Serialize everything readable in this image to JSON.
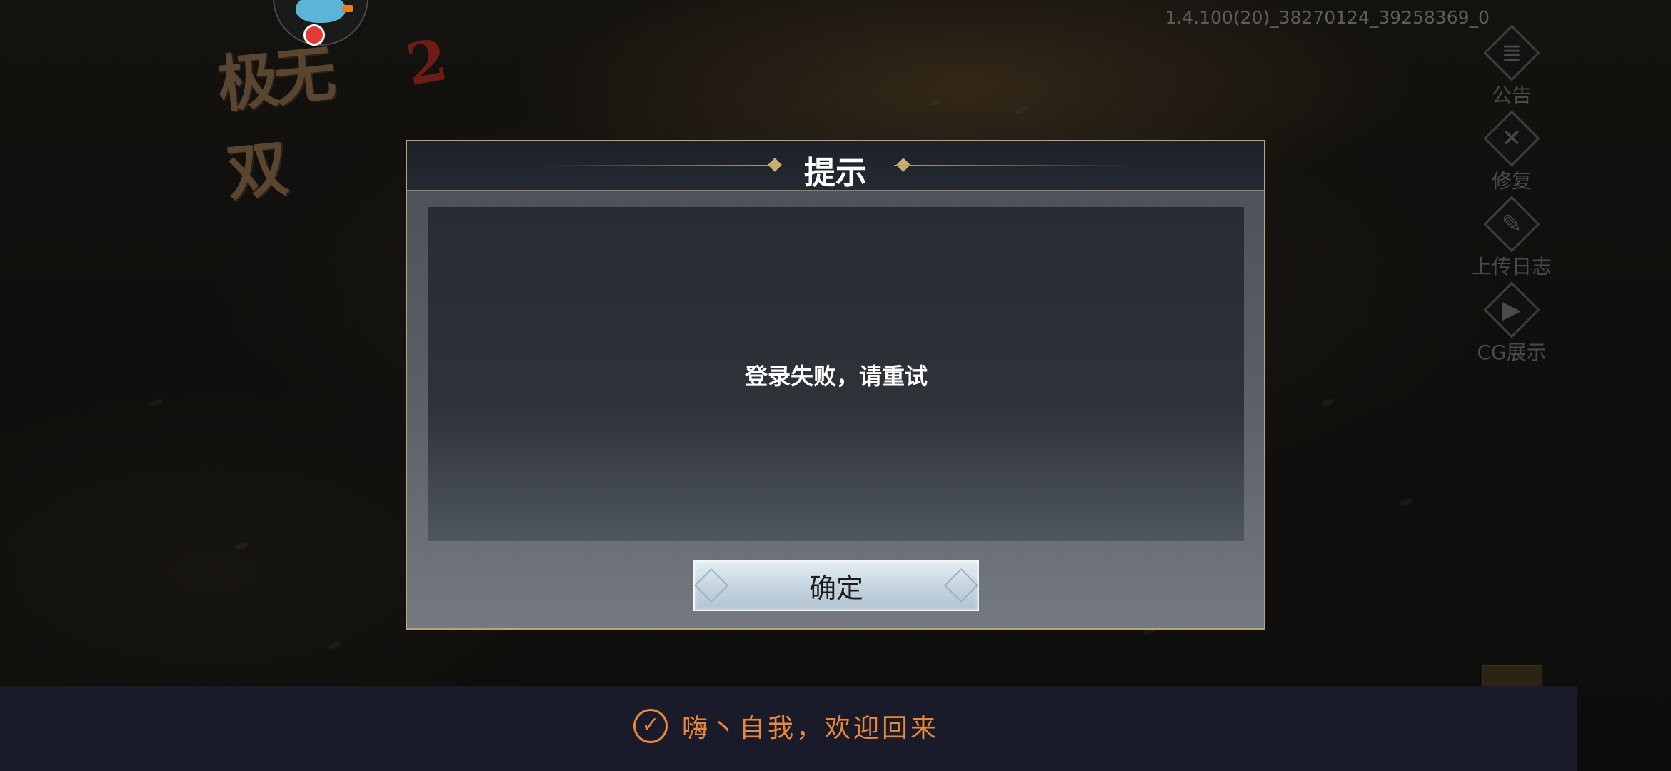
{
  "game": {
    "logo_text": "极无双",
    "logo_number": "2"
  },
  "version": "1.4.100(20)_38270124_39258369_0",
  "side_menu": [
    {
      "icon": "announcement-icon",
      "glyph": "≣",
      "label": "公告"
    },
    {
      "icon": "repair-icon",
      "glyph": "✕",
      "label": "修复"
    },
    {
      "icon": "upload-log-icon",
      "glyph": "✎",
      "label": "上传日志"
    },
    {
      "icon": "cg-video-icon",
      "glyph": "▶",
      "label": "CG展示"
    }
  ],
  "dialog": {
    "title": "提示",
    "message": "登录失败，请重试",
    "confirm_label": "确定"
  },
  "toast": {
    "icon": "check-circle-icon",
    "text": "嗨丶自我，欢迎回来"
  },
  "colors": {
    "accent_orange": "#e8893a",
    "dialog_border": "#b8a57c",
    "toast_bg": "#191a2a"
  }
}
